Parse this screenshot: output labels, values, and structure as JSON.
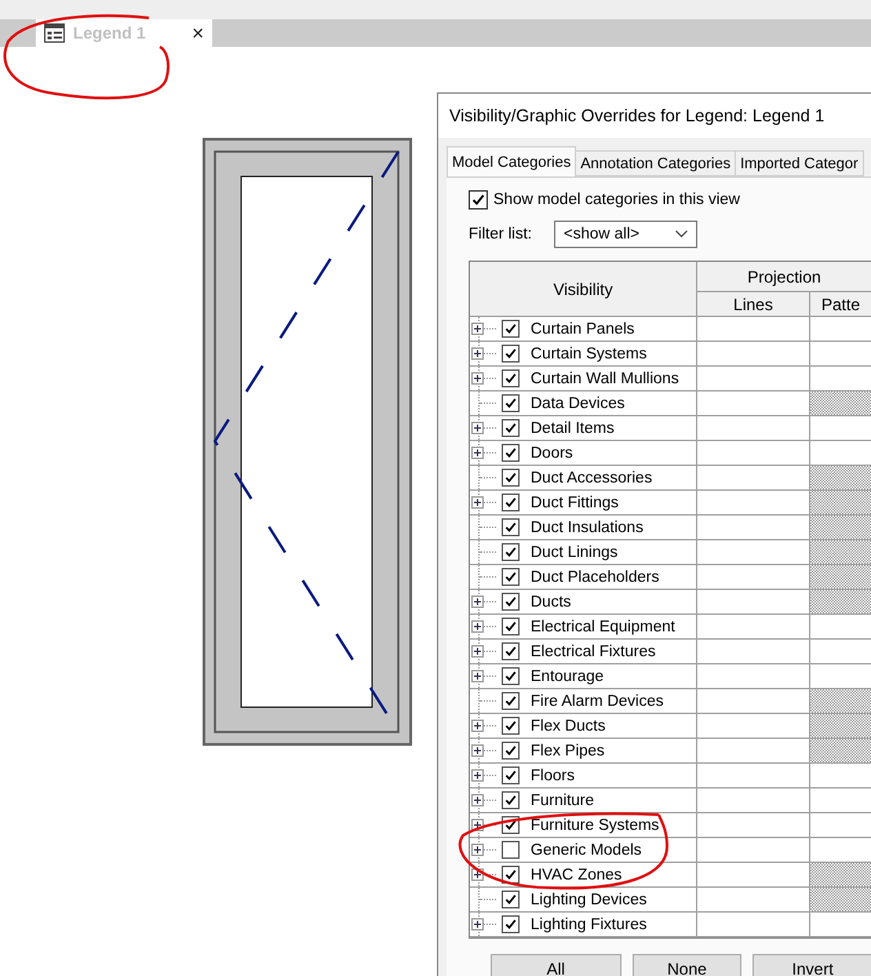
{
  "document_tab": {
    "title": "Legend 1",
    "close": "×"
  },
  "dialog": {
    "title": "Visibility/Graphic Overrides for Legend: Legend 1",
    "tabs": [
      {
        "label": "Model Categories",
        "selected": true
      },
      {
        "label": "Annotation Categories",
        "selected": false
      },
      {
        "label": "Imported Categor",
        "selected": false
      }
    ],
    "show_categories": {
      "label": "Show model categories in this view",
      "checked": true
    },
    "filter": {
      "label": "Filter list:",
      "value": "<show all>"
    },
    "table": {
      "visibility_header": "Visibility",
      "group_header": "Projection",
      "columns": [
        "Lines",
        "Patte"
      ],
      "rows": [
        {
          "name": "Curtain Panels",
          "checked": true,
          "expandable": true,
          "hatched": false
        },
        {
          "name": "Curtain Systems",
          "checked": true,
          "expandable": true,
          "hatched": false
        },
        {
          "name": "Curtain Wall Mullions",
          "checked": true,
          "expandable": true,
          "hatched": false
        },
        {
          "name": "Data Devices",
          "checked": true,
          "expandable": false,
          "hatched": true
        },
        {
          "name": "Detail Items",
          "checked": true,
          "expandable": true,
          "hatched": false
        },
        {
          "name": "Doors",
          "checked": true,
          "expandable": true,
          "hatched": false
        },
        {
          "name": "Duct Accessories",
          "checked": true,
          "expandable": false,
          "hatched": true
        },
        {
          "name": "Duct Fittings",
          "checked": true,
          "expandable": true,
          "hatched": true
        },
        {
          "name": "Duct Insulations",
          "checked": true,
          "expandable": false,
          "hatched": true
        },
        {
          "name": "Duct Linings",
          "checked": true,
          "expandable": false,
          "hatched": true
        },
        {
          "name": "Duct Placeholders",
          "checked": true,
          "expandable": false,
          "hatched": true
        },
        {
          "name": "Ducts",
          "checked": true,
          "expandable": true,
          "hatched": true
        },
        {
          "name": "Electrical Equipment",
          "checked": true,
          "expandable": true,
          "hatched": false
        },
        {
          "name": "Electrical Fixtures",
          "checked": true,
          "expandable": true,
          "hatched": false
        },
        {
          "name": "Entourage",
          "checked": true,
          "expandable": true,
          "hatched": false
        },
        {
          "name": "Fire Alarm Devices",
          "checked": true,
          "expandable": false,
          "hatched": true
        },
        {
          "name": "Flex Ducts",
          "checked": true,
          "expandable": true,
          "hatched": true
        },
        {
          "name": "Flex Pipes",
          "checked": true,
          "expandable": true,
          "hatched": true
        },
        {
          "name": "Floors",
          "checked": true,
          "expandable": true,
          "hatched": false
        },
        {
          "name": "Furniture",
          "checked": true,
          "expandable": true,
          "hatched": false
        },
        {
          "name": "Furniture Systems",
          "checked": true,
          "expandable": true,
          "hatched": false
        },
        {
          "name": "Generic Models",
          "checked": false,
          "expandable": true,
          "hatched": false
        },
        {
          "name": "HVAC Zones",
          "checked": true,
          "expandable": true,
          "hatched": true
        },
        {
          "name": "Lighting Devices",
          "checked": true,
          "expandable": false,
          "hatched": true
        },
        {
          "name": "Lighting Fixtures",
          "checked": true,
          "expandable": true,
          "hatched": false
        }
      ]
    },
    "buttons": [
      "All",
      "None",
      "Invert"
    ]
  }
}
